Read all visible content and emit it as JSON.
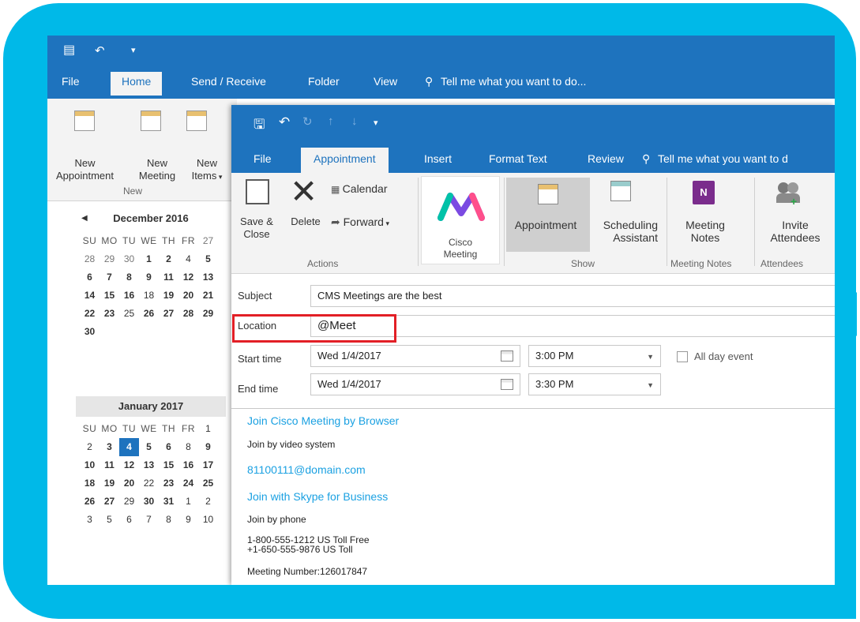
{
  "back_window": {
    "tabs": [
      "File",
      "Home",
      "Send / Receive",
      "Folder",
      "View"
    ],
    "tell_me": "Tell me what you want to do...",
    "ribbon": {
      "new_appointment": [
        "New",
        "Appointment"
      ],
      "new_meeting": [
        "New",
        "Meeting"
      ],
      "new_items": [
        "New",
        "Items"
      ],
      "group_label": "New"
    },
    "calendars": [
      {
        "month": "December 2016",
        "days_of_week": [
          "SU",
          "MO",
          "TU",
          "WE",
          "TH",
          "FR"
        ],
        "rows": [
          [
            "27",
            "28",
            "29",
            "30",
            "1",
            "2"
          ],
          [
            "4",
            "5",
            "6",
            "7",
            "8",
            "9"
          ],
          [
            "11",
            "12",
            "13",
            "14",
            "15",
            "16"
          ],
          [
            "18",
            "19",
            "20",
            "21",
            "22",
            "23"
          ],
          [
            "25",
            "26",
            "27",
            "28",
            "29",
            "30"
          ]
        ]
      },
      {
        "month": "January 2017",
        "days_of_week": [
          "SU",
          "MO",
          "TU",
          "WE",
          "TH",
          "FR"
        ],
        "rows": [
          [
            "1",
            "2",
            "3",
            "4",
            "5",
            "6"
          ],
          [
            "8",
            "9",
            "10",
            "11",
            "12",
            "13"
          ],
          [
            "15",
            "16",
            "17",
            "18",
            "19",
            "20"
          ],
          [
            "22",
            "23",
            "24",
            "25",
            "26",
            "27"
          ],
          [
            "29",
            "30",
            "31",
            "1",
            "2",
            "3"
          ],
          [
            "5",
            "6",
            "7",
            "8",
            "9",
            "10"
          ]
        ],
        "selected": "4"
      }
    ]
  },
  "front_window": {
    "tabs": [
      "File",
      "Appointment",
      "Insert",
      "Format Text",
      "Review"
    ],
    "active_tab": "Appointment",
    "tell_me": "Tell me what you want to d",
    "ribbon": {
      "save_close": [
        "Save &",
        "Close"
      ],
      "delete": "Delete",
      "calendar": "Calendar",
      "forward": "Forward",
      "actions_label": "Actions",
      "cisco_label": [
        "Cisco",
        "Meeting"
      ],
      "appointment": "Appointment",
      "scheduling": [
        "Scheduling",
        "Assistant"
      ],
      "show_label": "Show",
      "meeting_notes": [
        "Meeting",
        "Notes"
      ],
      "meeting_notes_label": "Meeting Notes",
      "invite": [
        "Invite",
        "Attendees"
      ],
      "attendees_label": "Attendees"
    },
    "form": {
      "subject_label": "Subject",
      "subject_value": "CMS Meetings are the best",
      "location_label": "Location",
      "location_value": "@Meet",
      "start_label": "Start time",
      "start_date": "Wed 1/4/2017",
      "start_time": "3:00 PM",
      "all_day_label": "All day event",
      "end_label": "End time",
      "end_date": "Wed 1/4/2017",
      "end_time": "3:30 PM"
    },
    "body": {
      "join_browser": "Join Cisco Meeting by Browser",
      "join_video": "Join by video system",
      "video_address": "81100111@domain.com",
      "join_skype": "Join with Skype for Business",
      "join_phone": "Join by phone",
      "toll_free": "1-800-555-1212 US Toll Free",
      "toll": "+1-650-555-9876 US Toll",
      "meeting_number": "Meeting Number:126017847"
    }
  },
  "colors": {
    "frame": "#00b9e8",
    "outlook_blue": "#1e73be",
    "highlight": "#e21f26",
    "link": "#1ba1e2"
  }
}
